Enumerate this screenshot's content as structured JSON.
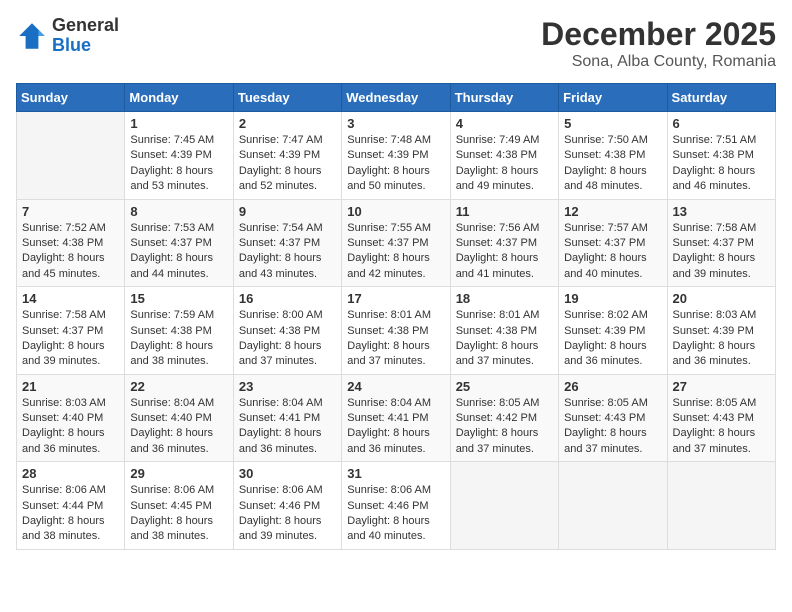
{
  "logo": {
    "line1": "General",
    "line2": "Blue"
  },
  "title": "December 2025",
  "subtitle": "Sona, Alba County, Romania",
  "days_of_week": [
    "Sunday",
    "Monday",
    "Tuesday",
    "Wednesday",
    "Thursday",
    "Friday",
    "Saturday"
  ],
  "weeks": [
    [
      {
        "day": "",
        "sunrise": "",
        "sunset": "",
        "daylight": ""
      },
      {
        "day": "1",
        "sunrise": "7:45 AM",
        "sunset": "4:39 PM",
        "daylight": "8 hours and 53 minutes."
      },
      {
        "day": "2",
        "sunrise": "7:47 AM",
        "sunset": "4:39 PM",
        "daylight": "8 hours and 52 minutes."
      },
      {
        "day": "3",
        "sunrise": "7:48 AM",
        "sunset": "4:39 PM",
        "daylight": "8 hours and 50 minutes."
      },
      {
        "day": "4",
        "sunrise": "7:49 AM",
        "sunset": "4:38 PM",
        "daylight": "8 hours and 49 minutes."
      },
      {
        "day": "5",
        "sunrise": "7:50 AM",
        "sunset": "4:38 PM",
        "daylight": "8 hours and 48 minutes."
      },
      {
        "day": "6",
        "sunrise": "7:51 AM",
        "sunset": "4:38 PM",
        "daylight": "8 hours and 46 minutes."
      }
    ],
    [
      {
        "day": "7",
        "sunrise": "7:52 AM",
        "sunset": "4:38 PM",
        "daylight": "8 hours and 45 minutes."
      },
      {
        "day": "8",
        "sunrise": "7:53 AM",
        "sunset": "4:37 PM",
        "daylight": "8 hours and 44 minutes."
      },
      {
        "day": "9",
        "sunrise": "7:54 AM",
        "sunset": "4:37 PM",
        "daylight": "8 hours and 43 minutes."
      },
      {
        "day": "10",
        "sunrise": "7:55 AM",
        "sunset": "4:37 PM",
        "daylight": "8 hours and 42 minutes."
      },
      {
        "day": "11",
        "sunrise": "7:56 AM",
        "sunset": "4:37 PM",
        "daylight": "8 hours and 41 minutes."
      },
      {
        "day": "12",
        "sunrise": "7:57 AM",
        "sunset": "4:37 PM",
        "daylight": "8 hours and 40 minutes."
      },
      {
        "day": "13",
        "sunrise": "7:58 AM",
        "sunset": "4:37 PM",
        "daylight": "8 hours and 39 minutes."
      }
    ],
    [
      {
        "day": "14",
        "sunrise": "7:58 AM",
        "sunset": "4:37 PM",
        "daylight": "8 hours and 39 minutes."
      },
      {
        "day": "15",
        "sunrise": "7:59 AM",
        "sunset": "4:38 PM",
        "daylight": "8 hours and 38 minutes."
      },
      {
        "day": "16",
        "sunrise": "8:00 AM",
        "sunset": "4:38 PM",
        "daylight": "8 hours and 37 minutes."
      },
      {
        "day": "17",
        "sunrise": "8:01 AM",
        "sunset": "4:38 PM",
        "daylight": "8 hours and 37 minutes."
      },
      {
        "day": "18",
        "sunrise": "8:01 AM",
        "sunset": "4:38 PM",
        "daylight": "8 hours and 37 minutes."
      },
      {
        "day": "19",
        "sunrise": "8:02 AM",
        "sunset": "4:39 PM",
        "daylight": "8 hours and 36 minutes."
      },
      {
        "day": "20",
        "sunrise": "8:03 AM",
        "sunset": "4:39 PM",
        "daylight": "8 hours and 36 minutes."
      }
    ],
    [
      {
        "day": "21",
        "sunrise": "8:03 AM",
        "sunset": "4:40 PM",
        "daylight": "8 hours and 36 minutes."
      },
      {
        "day": "22",
        "sunrise": "8:04 AM",
        "sunset": "4:40 PM",
        "daylight": "8 hours and 36 minutes."
      },
      {
        "day": "23",
        "sunrise": "8:04 AM",
        "sunset": "4:41 PM",
        "daylight": "8 hours and 36 minutes."
      },
      {
        "day": "24",
        "sunrise": "8:04 AM",
        "sunset": "4:41 PM",
        "daylight": "8 hours and 36 minutes."
      },
      {
        "day": "25",
        "sunrise": "8:05 AM",
        "sunset": "4:42 PM",
        "daylight": "8 hours and 37 minutes."
      },
      {
        "day": "26",
        "sunrise": "8:05 AM",
        "sunset": "4:43 PM",
        "daylight": "8 hours and 37 minutes."
      },
      {
        "day": "27",
        "sunrise": "8:05 AM",
        "sunset": "4:43 PM",
        "daylight": "8 hours and 37 minutes."
      }
    ],
    [
      {
        "day": "28",
        "sunrise": "8:06 AM",
        "sunset": "4:44 PM",
        "daylight": "8 hours and 38 minutes."
      },
      {
        "day": "29",
        "sunrise": "8:06 AM",
        "sunset": "4:45 PM",
        "daylight": "8 hours and 38 minutes."
      },
      {
        "day": "30",
        "sunrise": "8:06 AM",
        "sunset": "4:46 PM",
        "daylight": "8 hours and 39 minutes."
      },
      {
        "day": "31",
        "sunrise": "8:06 AM",
        "sunset": "4:46 PM",
        "daylight": "8 hours and 40 minutes."
      },
      {
        "day": "",
        "sunrise": "",
        "sunset": "",
        "daylight": ""
      },
      {
        "day": "",
        "sunrise": "",
        "sunset": "",
        "daylight": ""
      },
      {
        "day": "",
        "sunrise": "",
        "sunset": "",
        "daylight": ""
      }
    ]
  ]
}
